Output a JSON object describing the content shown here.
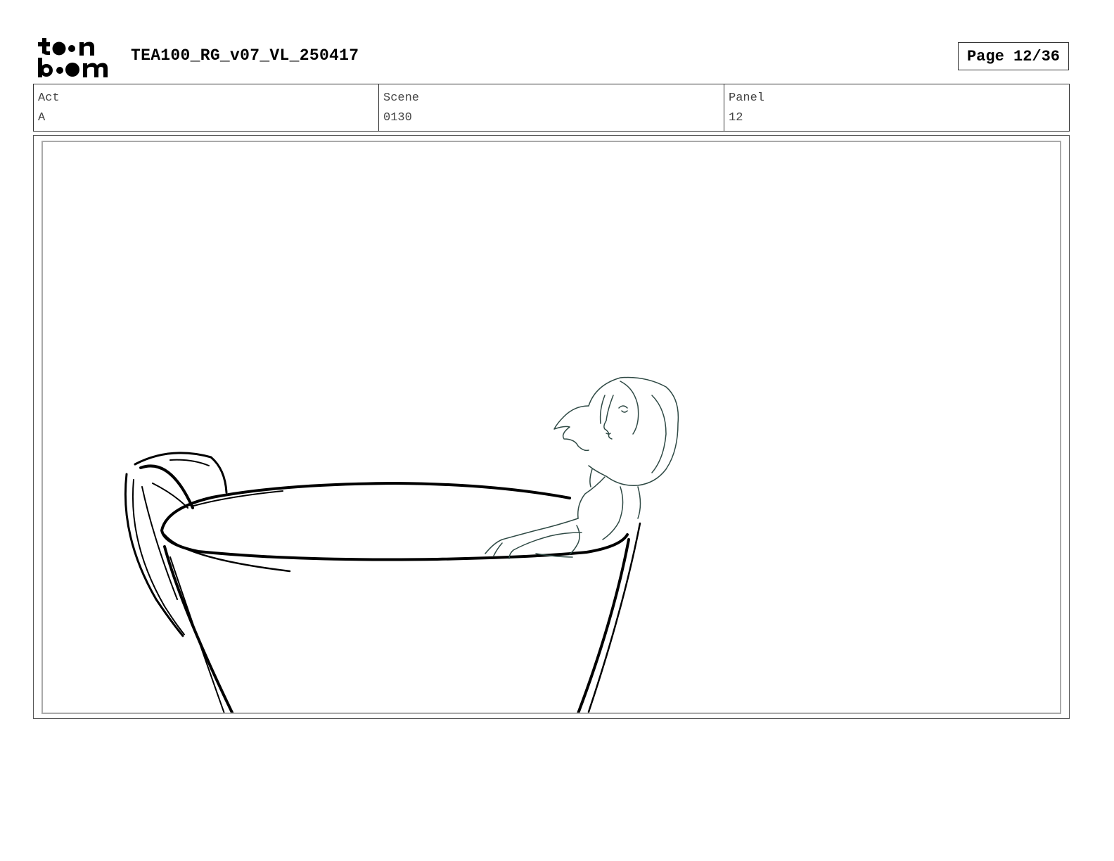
{
  "header": {
    "logo_text": "toon boom",
    "document_title": "TEA100_RG_v07_VL_250417",
    "page_label": "Page 12/36"
  },
  "info": {
    "act_label": "Act",
    "act_value": "A",
    "scene_label": "Scene",
    "scene_value": "0130",
    "panel_label": "Panel",
    "panel_value": "12"
  },
  "panel_image": {
    "icon": "storyboard-sketch-teacup-girl",
    "line_color": "#000000",
    "character_line_color": "#2f4a45"
  }
}
